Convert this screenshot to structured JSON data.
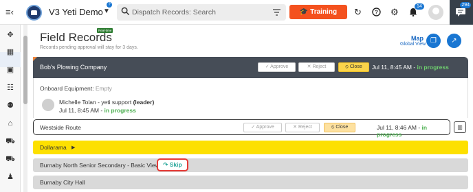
{
  "topbar": {
    "app_name": "V3 Yeti Demo",
    "help_badge": "?",
    "search_placeholder": "Dispatch Records: Search",
    "training_label": "Training",
    "notification_count": "14",
    "chat_count": "294"
  },
  "header": {
    "title": "Field Records",
    "realtime_badge": "Real-time",
    "subtitle": "Records pending approval will stay for 3 days.",
    "map_label": "Map",
    "map_sublabel": "Global View"
  },
  "company": {
    "name": "Bob's Plowing Company",
    "approve_label": "Approve",
    "reject_label": "Reject",
    "close_label": "Close",
    "time": "Jul 11, 8:45 AM - ",
    "status": "in progress"
  },
  "equipment": {
    "label": "Onboard Equipment:",
    "value": "Empty",
    "person_name": "Michelle Tolan - yeti support",
    "person_role": "(leader)",
    "person_time": "Jul 11, 8:45 AM - ",
    "person_status": "in progress"
  },
  "route": {
    "name": "Westside Route",
    "approve_label": "Approve",
    "reject_label": "Reject",
    "close_label": "Close",
    "time": "Jul 11, 8:46 AM - ",
    "status": "in progress"
  },
  "stops": [
    {
      "name": "Dollarama"
    },
    {
      "name": "Burnaby North Senior Secondary - Basic View"
    },
    {
      "name": "Burnaby City Hall"
    }
  ],
  "skip_label": "Skip",
  "colors": {
    "accent": "#1976d2",
    "training": "#f4511e",
    "company_header": "#464d57",
    "status_green": "#4caf50",
    "stop_yellow": "#fde000"
  }
}
